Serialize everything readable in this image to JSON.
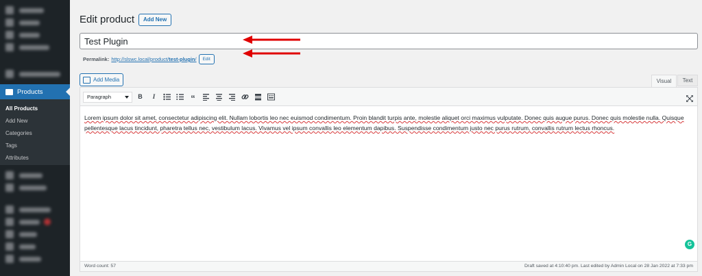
{
  "sidebar": {
    "products_label": "Products",
    "submenu": [
      {
        "label": "All Products"
      },
      {
        "label": "Add New"
      },
      {
        "label": "Categories"
      },
      {
        "label": "Tags"
      },
      {
        "label": "Attributes"
      }
    ]
  },
  "header": {
    "title": "Edit product",
    "add_new_label": "Add New"
  },
  "post_title": {
    "value": "Test Plugin"
  },
  "permalink": {
    "label": "Permalink:",
    "base_url": "http://slswc.local/product/",
    "slug": "test-plugin",
    "trailing": "/",
    "edit_label": "Edit"
  },
  "editor": {
    "add_media_label": "Add Media",
    "tab_visual": "Visual",
    "tab_text": "Text",
    "format_select": "Paragraph",
    "toolbar_icons": [
      "bold-icon",
      "italic-icon",
      "bulleted-list-icon",
      "numbered-list-icon",
      "blockquote-icon",
      "align-left-icon",
      "align-center-icon",
      "align-right-icon",
      "link-icon",
      "read-more-icon",
      "toolbar-toggle-icon",
      "fullscreen-icon"
    ],
    "bold_glyph": "B",
    "italic_glyph": "I",
    "quote_glyph": "“",
    "content": "Lorem ipsum dolor sit amet, consectetur adipiscing elit. Nullam lobortis leo nec euismod condimentum. Proin blandit turpis ante, molestie aliquet orci maximus vulputate. Donec quis augue purus. Donec quis molestie nulla. Quisque pellentesque lacus tincidunt, pharetra tellus nec, vestibulum lacus. Vivamus vel ipsum convallis leo elementum dapibus. Suspendisse condimentum justo nec purus rutrum, convallis rutrum lectus rhoncus."
  },
  "status_bar": {
    "word_count": "Word count: 57",
    "autosave": "Draft saved at 4:10:40 pm. Last edited by Admin Local on 28 Jan 2022 at 7:33 pm"
  },
  "grammarly": {
    "glyph": "G",
    "color": "#15c39a"
  },
  "colors": {
    "accent": "#2271b1",
    "sidebar_bg": "#1d2327",
    "annotation_arrow": "#e00000"
  }
}
